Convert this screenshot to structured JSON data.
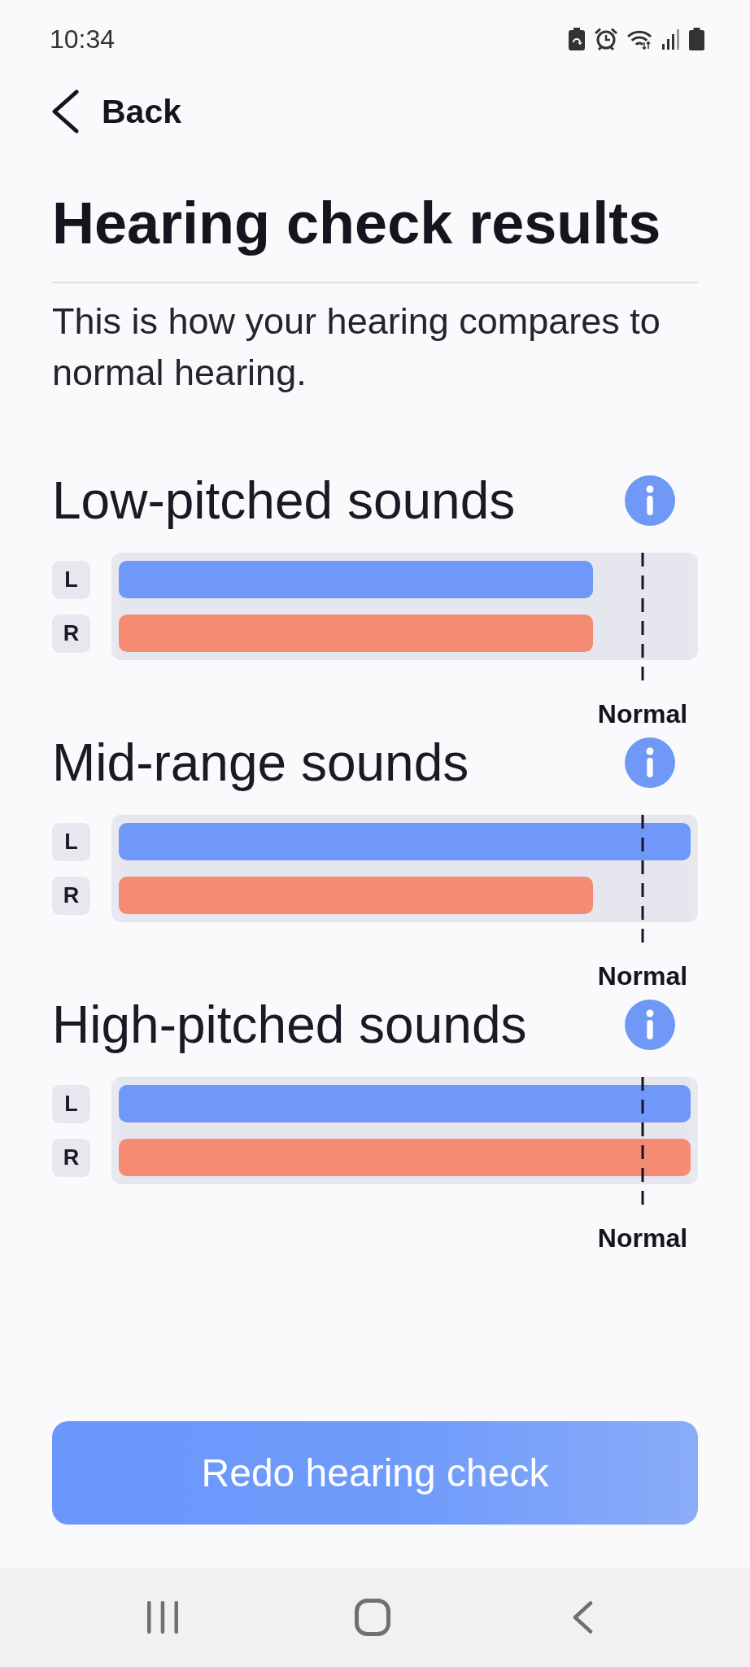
{
  "status_bar": {
    "time": "10:34"
  },
  "header": {
    "back_label": "Back",
    "title": "Hearing check results"
  },
  "description": "This is how your hearing compares to normal hearing.",
  "sections": [
    {
      "title": "Low-pitched sounds",
      "ears": [
        {
          "label": "L",
          "level": 0.83,
          "color": "#6f98fa"
        },
        {
          "label": "R",
          "level": 0.83,
          "color": "#f48b72"
        }
      ],
      "marker_label": "Normal"
    },
    {
      "title": "Mid-range sounds",
      "ears": [
        {
          "label": "L",
          "level": 1,
          "color": "#6f98fa"
        },
        {
          "label": "R",
          "level": 0.83,
          "color": "#f48b72"
        }
      ],
      "marker_label": "Normal"
    },
    {
      "title": "High-pitched sounds",
      "ears": [
        {
          "label": "L",
          "level": 1,
          "color": "#6f98fa"
        },
        {
          "label": "R",
          "level": 1,
          "color": "#f48b72"
        }
      ],
      "marker_label": "Normal"
    }
  ],
  "button": {
    "label": "Redo hearing check"
  }
}
